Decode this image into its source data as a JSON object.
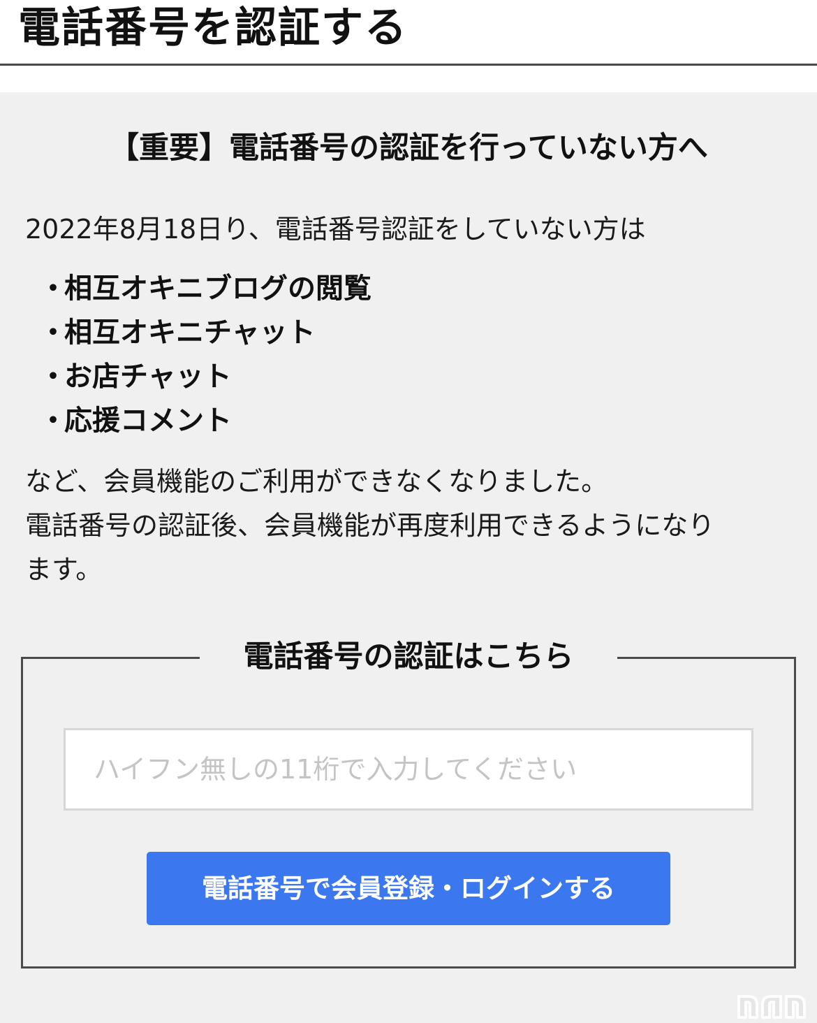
{
  "header": {
    "title": "電話番号を認証する"
  },
  "notice": {
    "heading": "【重要】電話番号の認証を行っていない方へ",
    "intro": "2022年8月18日り、電話番号認証をしていない方は",
    "bullet": "・",
    "features": [
      "相互オキニブログの閲覧",
      "相互オキニチャット",
      "お店チャット",
      "応援コメント"
    ],
    "outro_line1": "など、会員機能のご利用ができなくなりました。",
    "outro_line2": "電話番号の認証後、会員機能が再度利用できるようになり",
    "outro_line3": "ます。"
  },
  "verify": {
    "title": "電話番号の認証はこちら",
    "input_value": "",
    "input_placeholder": "ハイフン無しの11桁で入力してください",
    "button_label": "電話番号で会員登録・ログインする"
  },
  "colors": {
    "panel_bg": "#f0f0f0",
    "button_bg": "#3b78f0",
    "button_text": "#ffffff",
    "border": "#4a4a4a"
  },
  "watermark": {
    "icon": "site-logo-watermark"
  }
}
